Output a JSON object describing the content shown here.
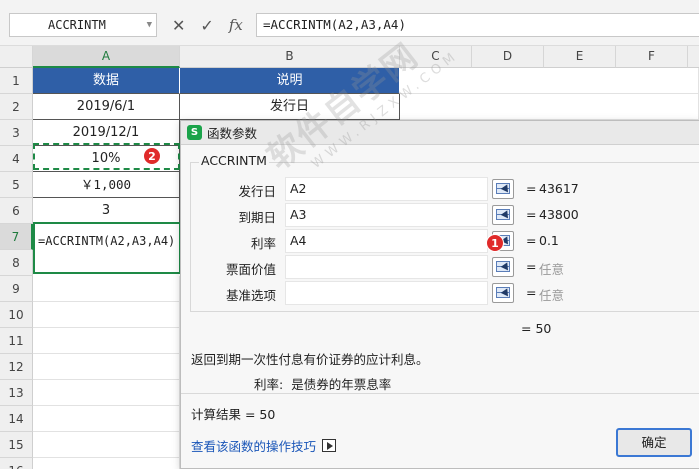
{
  "formula_bar": {
    "name_box": "ACCRINTM",
    "cancel_icon": "✕",
    "confirm_icon": "✓",
    "fx_label": "fx",
    "formula": "=ACCRINTM(A2,A3,A4)"
  },
  "columns": [
    "A",
    "B",
    "C",
    "D",
    "E",
    "F"
  ],
  "rows": [
    "1",
    "2",
    "3",
    "4",
    "5",
    "6",
    "7",
    "8",
    "9",
    "10",
    "11",
    "12",
    "13",
    "14",
    "15",
    "16"
  ],
  "cells": {
    "A1": "数据",
    "B1": "说明",
    "A2": "2019/6/1",
    "B2": "发行日",
    "A3": "2019/12/1",
    "A4": "10%",
    "A5": "￥1,000",
    "A6": "3",
    "A7": "=ACCRINTM(A2,A3,A4)"
  },
  "badges": {
    "one": "1",
    "two": "2"
  },
  "dialog": {
    "title": "函数参数",
    "app_icon": "S",
    "function_name": "ACCRINTM",
    "args": [
      {
        "label": "发行日",
        "input": "A2",
        "eq": "=",
        "value": "43617"
      },
      {
        "label": "到期日",
        "input": "A3",
        "eq": "=",
        "value": "43800"
      },
      {
        "label": "利率",
        "input": "A4",
        "eq": "=",
        "value": "0.1"
      },
      {
        "label": "票面价值",
        "input": "",
        "eq": "=",
        "value": "任意"
      },
      {
        "label": "基准选项",
        "input": "",
        "eq": "=",
        "value": "任意"
      }
    ],
    "total": "=   50",
    "description": "返回到期一次性付息有价证券的应计利息。",
    "param_name": "利率:",
    "param_desc": "是债券的年票息率",
    "calc_result": "计算结果  =   50",
    "tips_link": "查看该函数的操作技巧",
    "ok": "确定"
  },
  "watermark": {
    "main": "软件自学网",
    "sub": "WWW.RJZXW.COM"
  }
}
